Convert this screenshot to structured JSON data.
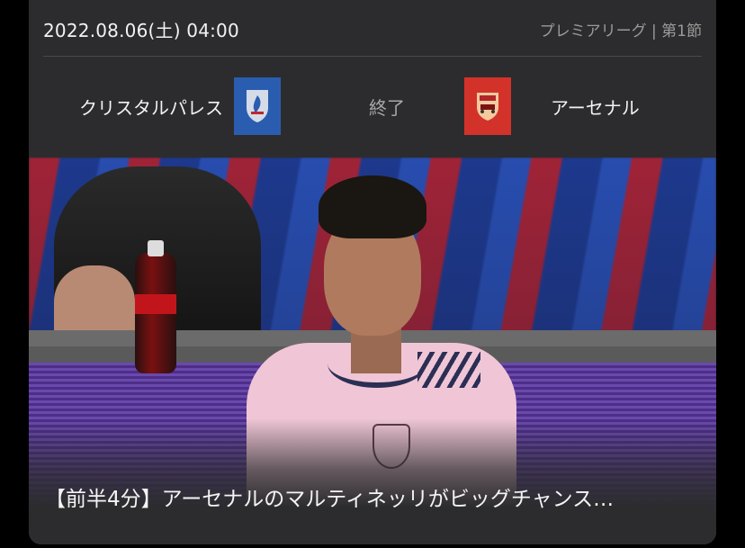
{
  "match": {
    "datetime": "2022.08.06(土) 04:00",
    "league": "プレミアリーグ | 第1節",
    "home_team": "クリスタルパレス",
    "away_team": "アーセナル",
    "status": "終了"
  },
  "crests": {
    "home_icon": "crystal-palace-crest-icon",
    "home_color": "#2a5db0",
    "away_icon": "arsenal-crest-icon",
    "away_color": "#d3322b"
  },
  "video": {
    "caption": "【前半4分】アーセナルのマルティネッリがビッグチャンス…"
  }
}
